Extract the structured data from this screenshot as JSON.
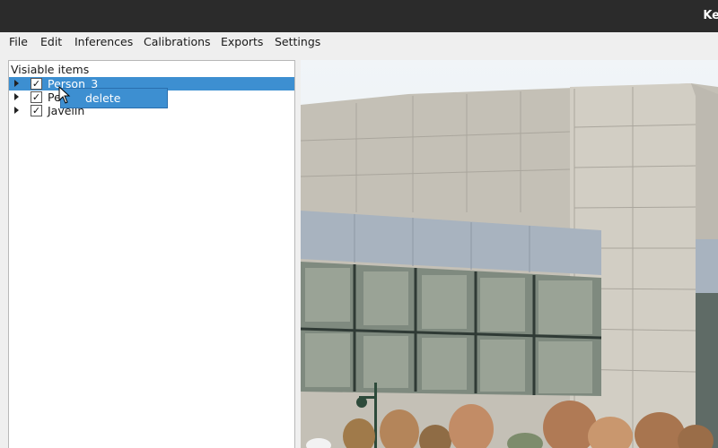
{
  "window": {
    "title": "Ke"
  },
  "menu": [
    "File",
    "Edit",
    "Inferences",
    "Calibrations",
    "Exports",
    "Settings"
  ],
  "panel": {
    "header": "Visiable items",
    "items": [
      {
        "label": "Person_3",
        "checked": true,
        "selected": true
      },
      {
        "label": "Pe",
        "checked": true,
        "selected": false
      },
      {
        "label": "Javelin",
        "checked": true,
        "selected": false
      }
    ]
  },
  "context_menu": {
    "delete_label": "delete"
  },
  "checkmark": "✓"
}
